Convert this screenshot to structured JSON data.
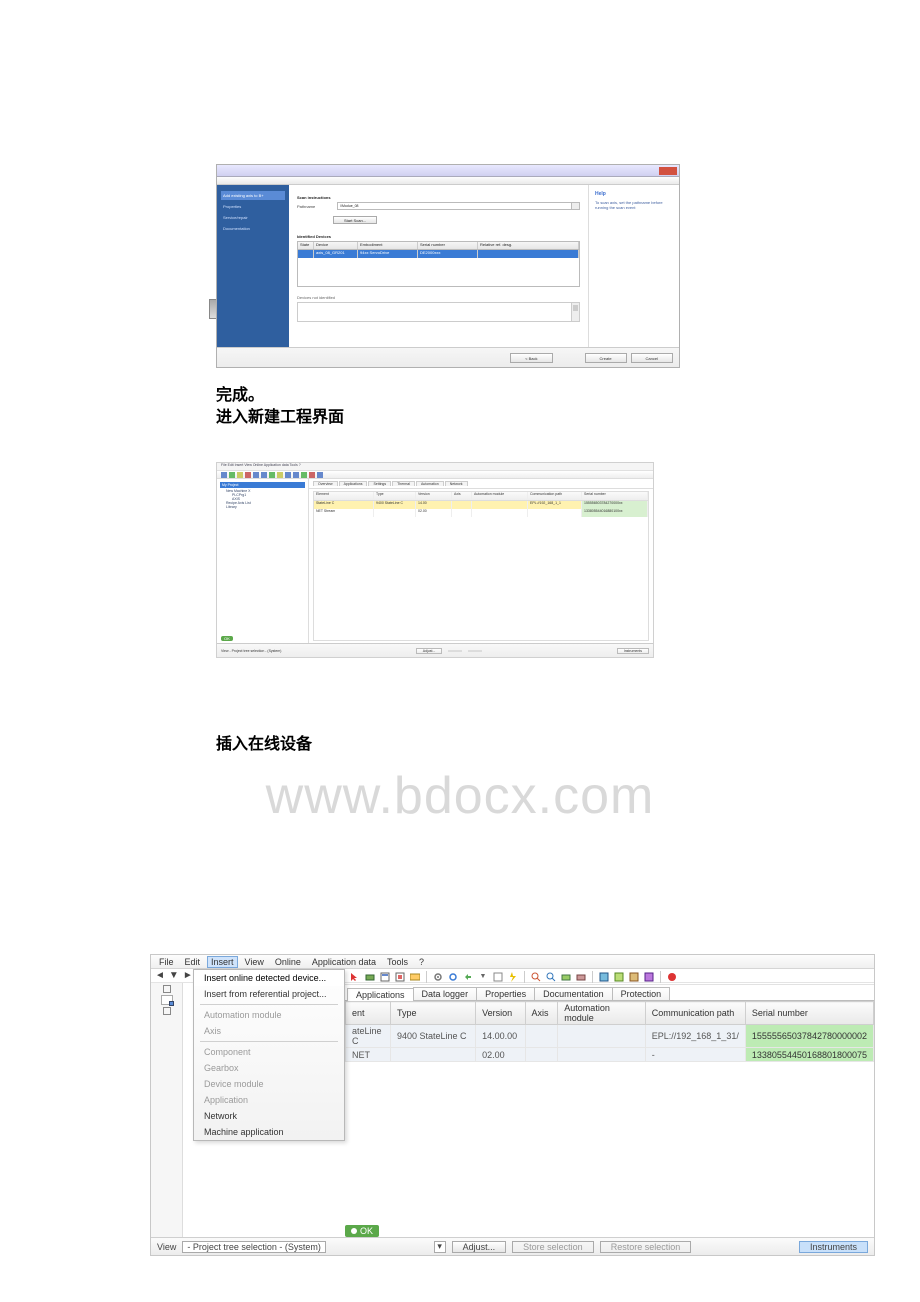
{
  "shot1": {
    "sidebar": {
      "selected": "Add existing axis to B+",
      "items": [
        "Properties",
        "Service/repair",
        "Documentation"
      ]
    },
    "main": {
      "sect_scan": "Scan instructions",
      "field_lbl": "Pathname",
      "field_value": "//Modue_08",
      "btn_scan": "Start Scan...",
      "sect_dev": "Identified Devices",
      "table": {
        "headers": [
          "State",
          "Device",
          "Embodiment",
          "Serial number",
          "Relative ref. desg."
        ],
        "row": [
          "",
          "axis_08_GR201",
          "94xx ServoDrive",
          "DE2000xxx",
          ""
        ]
      },
      "sect_notident": "Devices not identified"
    },
    "help": {
      "title": "Help",
      "text": "To scan axis, set the pathname before running the scan event"
    },
    "footer": {
      "back": "< Back",
      "spacer": "",
      "create": "Create",
      "cancel": "Cancel"
    }
  },
  "text1_line1": "完成。",
  "text1_line2": "进入新建工程界面",
  "shot2": {
    "menubar": "File  Edit  Insert  View  Online  Application data  Tools  ?",
    "tree": {
      "root": "My Project",
      "n1": "New Machine X",
      "n2": "PLCPrg1",
      "n3": "AXIS",
      "n4": "Recipe Axis List",
      "n5": "Library"
    },
    "tabs": [
      "Overview",
      "Applications",
      "Settings",
      "Thermal",
      "Automation",
      "Network"
    ],
    "grid": {
      "headers": [
        "Element",
        "Type",
        "Version",
        "Axis",
        "Automation module",
        "Communication path",
        "Serial number"
      ],
      "row1": [
        "StateLine C",
        "9400 StateLine C",
        "14.00",
        "",
        "",
        "EPL://192_168_1_1",
        "155556503784270000xx"
      ],
      "row2": [
        "NET Stream",
        "",
        "02.00",
        "",
        "",
        "",
        "133805544016880100xx"
      ]
    },
    "ok": "OK",
    "status": {
      "view": "View - Project tree selection - (System)",
      "adjust": "Adjust...",
      "instruments": "Instruments"
    }
  },
  "text2": "插入在线设备",
  "watermark": "www.bdocx.com",
  "shot3": {
    "menubar": [
      "File",
      "Edit",
      "Insert",
      "View",
      "Online",
      "Application data",
      "Tools",
      "?"
    ],
    "nav_arrows": [
      "◄",
      "▼",
      "►"
    ],
    "dropdown": {
      "insert_detected": "Insert online detected device...",
      "insert_ref": "Insert from referential project...",
      "automation": "Automation module",
      "axis": "Axis",
      "component": "Component",
      "gearbox": "Gearbox",
      "devmod": "Device module",
      "application": "Application",
      "network": "Network",
      "machapp": "Machine application"
    },
    "tabs": [
      "Applications",
      "Data logger",
      "Properties",
      "Documentation",
      "Protection"
    ],
    "grid": {
      "headers": [
        "ent",
        "Type",
        "Version",
        "Axis",
        "Automation module",
        "Communication path",
        "Serial number"
      ],
      "row1": [
        "ateLine C",
        "9400 StateLine C",
        "14.00.00",
        "",
        "",
        "EPL://192_168_1_31/",
        "15555565037842780000002"
      ],
      "row2": [
        "NET",
        "",
        "02.00",
        "",
        "",
        "-",
        "13380554450168801800075"
      ]
    },
    "ok": "OK",
    "status": {
      "view_lbl": "View",
      "view_val": "- Project tree selection - (System)",
      "adjust": "Adjust...",
      "store": "Store selection",
      "restore": "Restore selection",
      "instruments": "Instruments"
    }
  }
}
